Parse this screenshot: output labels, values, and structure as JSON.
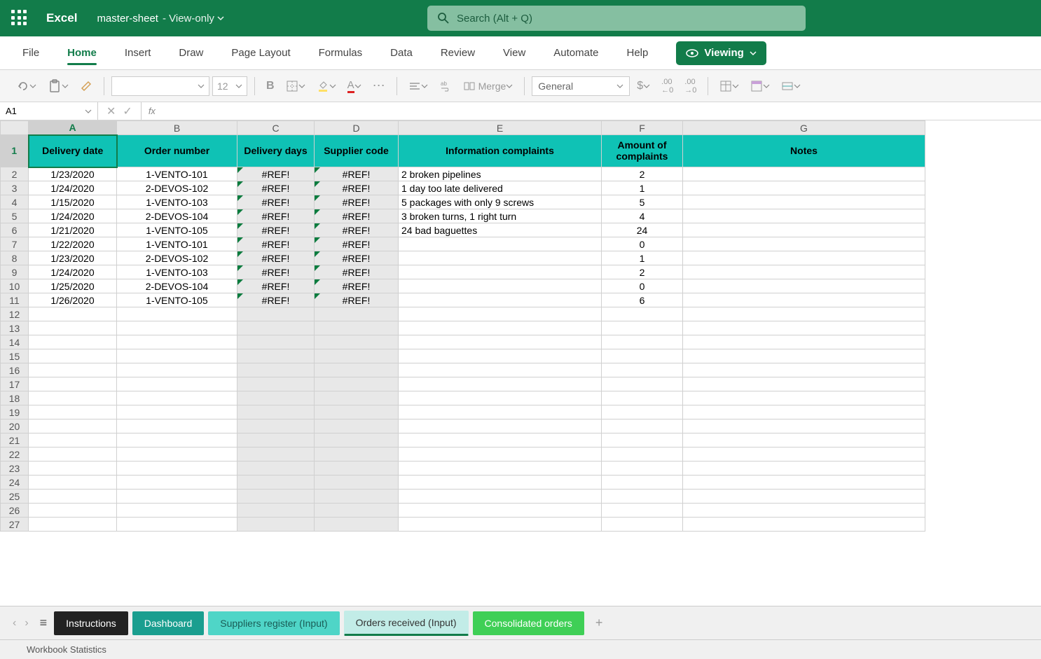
{
  "app": {
    "name": "Excel",
    "doc": "master-sheet",
    "mode": " - View-only"
  },
  "search": {
    "placeholder": "Search (Alt + Q)"
  },
  "tabs": {
    "file": "File",
    "home": "Home",
    "insert": "Insert",
    "draw": "Draw",
    "page": "Page Layout",
    "formulas": "Formulas",
    "data": "Data",
    "review": "Review",
    "view": "View",
    "automate": "Automate",
    "help": "Help",
    "viewing": "Viewing"
  },
  "toolbar": {
    "font_size": "12",
    "merge": "Merge",
    "number_format": "General"
  },
  "name_box": "A1",
  "columns": [
    "A",
    "B",
    "C",
    "D",
    "E",
    "F",
    "G"
  ],
  "headers": {
    "A": "Delivery date",
    "B": "Order number",
    "C": "Delivery days",
    "D": "Supplier code",
    "E": "Information complaints",
    "F": "Amount of complaints",
    "G": "Notes"
  },
  "rows": [
    {
      "A": "1/23/2020",
      "B": "1-VENTO-101",
      "C": "#REF!",
      "D": "#REF!",
      "E": "2 broken pipelines",
      "F": "2",
      "G": ""
    },
    {
      "A": "1/24/2020",
      "B": "2-DEVOS-102",
      "C": "#REF!",
      "D": "#REF!",
      "E": "1 day too late delivered",
      "F": "1",
      "G": ""
    },
    {
      "A": "1/15/2020",
      "B": "1-VENTO-103",
      "C": "#REF!",
      "D": "#REF!",
      "E": "5 packages with only 9 screws",
      "F": "5",
      "G": ""
    },
    {
      "A": "1/24/2020",
      "B": "2-DEVOS-104",
      "C": "#REF!",
      "D": "#REF!",
      "E": "3 broken turns, 1 right turn",
      "F": "4",
      "G": ""
    },
    {
      "A": "1/21/2020",
      "B": "1-VENTO-105",
      "C": "#REF!",
      "D": "#REF!",
      "E": "24 bad baguettes",
      "F": "24",
      "G": ""
    },
    {
      "A": "1/22/2020",
      "B": "1-VENTO-101",
      "C": "#REF!",
      "D": "#REF!",
      "E": "",
      "F": "0",
      "G": ""
    },
    {
      "A": "1/23/2020",
      "B": "2-DEVOS-102",
      "C": "#REF!",
      "D": "#REF!",
      "E": "",
      "F": "1",
      "G": ""
    },
    {
      "A": "1/24/2020",
      "B": "1-VENTO-103",
      "C": "#REF!",
      "D": "#REF!",
      "E": "",
      "F": "2",
      "G": ""
    },
    {
      "A": "1/25/2020",
      "B": "2-DEVOS-104",
      "C": "#REF!",
      "D": "#REF!",
      "E": "",
      "F": "0",
      "G": ""
    },
    {
      "A": "1/26/2020",
      "B": "1-VENTO-105",
      "C": "#REF!",
      "D": "#REF!",
      "E": "",
      "F": "6",
      "G": ""
    }
  ],
  "sheets": {
    "instructions": "Instructions",
    "dashboard": "Dashboard",
    "suppliers": "Suppliers register (Input)",
    "orders": "Orders received (Input)",
    "consolidated": "Consolidated orders"
  },
  "status": "Workbook Statistics"
}
